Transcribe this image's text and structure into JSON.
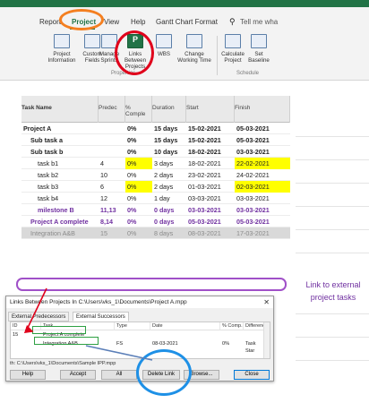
{
  "ribbon": {
    "tabs": [
      "Report",
      "Project",
      "View",
      "Help",
      "Gantt Chart Format"
    ],
    "active_tab": "Project",
    "search_placeholder": "Tell me wha",
    "buttons": [
      {
        "label": "Project Information",
        "icon": "project-info-icon"
      },
      {
        "label": "Custom Fields",
        "icon": "custom-fields-icon"
      },
      {
        "label": "Manage Sprints",
        "icon": "manage-sprints-icon"
      },
      {
        "label": "Links Between Projects",
        "icon": "links-between-projects-icon"
      },
      {
        "label": "WBS",
        "icon": "wbs-icon"
      },
      {
        "label": "Change Working Time",
        "icon": "change-working-time-icon"
      },
      {
        "label": "Calculate Project",
        "icon": "calculate-project-icon"
      },
      {
        "label": "Set Baseline",
        "icon": "set-baseline-icon"
      }
    ],
    "group_properties": "Properties",
    "group_schedule": "Schedule"
  },
  "grid": {
    "headers": [
      "Task Name",
      "Predec",
      "% Comple",
      "Duration",
      "Start",
      "Finish"
    ],
    "rows": [
      {
        "name": "Project A",
        "pred": "",
        "pct": "0%",
        "dur": "15 days",
        "start": "15-02-2021",
        "finish": "05-03-2021",
        "style": "bold",
        "indent": 0
      },
      {
        "name": "Sub task a",
        "pred": "",
        "pct": "0%",
        "dur": "15 days",
        "start": "15-02-2021",
        "finish": "05-03-2021",
        "style": "bold",
        "indent": 1
      },
      {
        "name": "Sub task b",
        "pred": "",
        "pct": "0%",
        "dur": "10 days",
        "start": "18-02-2021",
        "finish": "03-03-2021",
        "style": "bold",
        "indent": 1
      },
      {
        "name": "task b1",
        "pred": "4",
        "pct": "0%",
        "dur": "3 days",
        "start": "18-02-2021",
        "finish": "22-02-2021",
        "style": "normal",
        "indent": 2,
        "hl_pct": true,
        "hl_fin": true
      },
      {
        "name": "task b2",
        "pred": "10",
        "pct": "0%",
        "dur": "2 days",
        "start": "23-02-2021",
        "finish": "24-02-2021",
        "style": "normal",
        "indent": 2
      },
      {
        "name": "task b3",
        "pred": "6",
        "pct": "0%",
        "dur": "2 days",
        "start": "01-03-2021",
        "finish": "02-03-2021",
        "style": "normal",
        "indent": 2,
        "hl_pct": true,
        "hl_fin": true
      },
      {
        "name": "task b4",
        "pred": "12",
        "pct": "0%",
        "dur": "1 day",
        "start": "03-03-2021",
        "finish": "03-03-2021",
        "style": "normal",
        "indent": 2
      },
      {
        "name": "milestone B",
        "pred": "11,13",
        "pct": "0%",
        "dur": "0 days",
        "start": "03-03-2021",
        "finish": "03-03-2021",
        "style": "purple",
        "indent": 2
      },
      {
        "name": "Project A complete",
        "pred": "8,14",
        "pct": "0%",
        "dur": "0 days",
        "start": "05-03-2021",
        "finish": "05-03-2021",
        "style": "purple",
        "indent": 1
      },
      {
        "name": "Integration A&B",
        "pred": "15",
        "pct": "0%",
        "dur": "8 days",
        "start": "08-03-2021",
        "finish": "17-03-2021",
        "style": "grey",
        "indent": 1
      }
    ]
  },
  "annotation": {
    "link_text": "Link to external project tasks"
  },
  "dialog": {
    "title": "Links Between Projects In C:\\Users\\vks_1\\Documents\\Project A.mpp",
    "close_glyph": "✕",
    "tabs": [
      "External Predecessors",
      "External Successors"
    ],
    "active_tab": "External Successors",
    "columns": [
      "ID",
      "Task",
      "Type",
      "Date",
      "% Comp.",
      "Difference"
    ],
    "rows": [
      {
        "id": "15",
        "task": "Project A complete",
        "type": "",
        "date": "",
        "pct": "",
        "diff": ""
      },
      {
        "id": "",
        "task": "Integration A&B",
        "type": "FS",
        "date": "08-03-2021",
        "pct": "0%",
        "diff": "Task Star Task Finis"
      }
    ],
    "path": "th: C:\\Users\\vks_1\\Documents\\Sample IPP.mpp",
    "buttons": [
      "Help",
      "Accept",
      "All",
      "Delete Link",
      "Browse...",
      "Close"
    ]
  }
}
